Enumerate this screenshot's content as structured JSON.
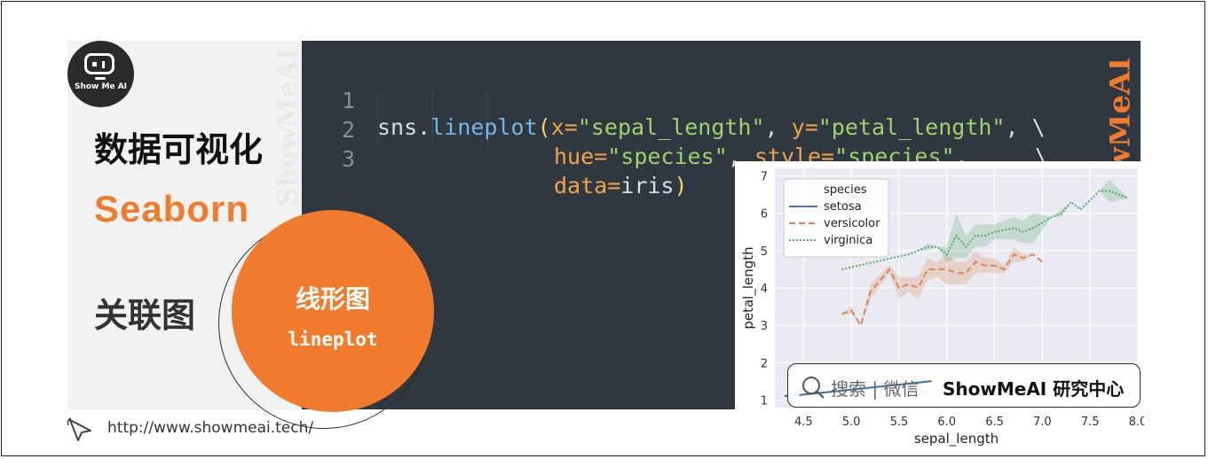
{
  "brand": {
    "logo_text": "Show Me AI",
    "watermark": "ShowMeAI"
  },
  "left": {
    "title_cn": "数据可视化",
    "title_en": "Seaborn",
    "subtitle_cn": "关联图"
  },
  "circle": {
    "title": "线形图",
    "subtitle": "lineplot"
  },
  "code": {
    "lines": [
      {
        "number": "1",
        "parts": [
          {
            "t": "sns.",
            "c": "#d7dde4"
          },
          {
            "t": "lineplot",
            "c": "#74b6e8"
          },
          {
            "t": "(",
            "c": "#f2d36b"
          },
          {
            "t": "x=",
            "c": "#f2a24b"
          },
          {
            "t": "\"sepal_length\"",
            "c": "#9fd26a"
          },
          {
            "t": ", ",
            "c": "#d7dde4"
          },
          {
            "t": "y=",
            "c": "#f2a24b"
          },
          {
            "t": "\"petal_length\"",
            "c": "#9fd26a"
          },
          {
            "t": ", \\",
            "c": "#d7dde4"
          }
        ]
      },
      {
        "number": "2",
        "parts": [
          {
            "t": "hue=",
            "c": "#f2a24b"
          },
          {
            "t": "\"species\"",
            "c": "#9fd26a"
          },
          {
            "t": ", ",
            "c": "#d7dde4"
          },
          {
            "t": "style=",
            "c": "#f2a24b"
          },
          {
            "t": "\"species\"",
            "c": "#9fd26a"
          },
          {
            "t": ",     \\",
            "c": "#d7dde4"
          }
        ]
      },
      {
        "number": "3",
        "parts": [
          {
            "t": "data=",
            "c": "#f2a24b"
          },
          {
            "t": "iris",
            "c": "#d7dde4"
          },
          {
            "t": ")",
            "c": "#f2d36b"
          }
        ]
      }
    ]
  },
  "url": {
    "text": "http://www.showmeai.tech/"
  },
  "search": {
    "placeholder": "搜索 | 微信",
    "brand": "ShowMeAI 研究中心"
  },
  "chart_data": {
    "type": "line",
    "xlabel": "sepal_length",
    "ylabel": "petal_length",
    "xticks": [
      "4.5",
      "5.0",
      "5.5",
      "6.0",
      "6.5",
      "7.0",
      "7.5",
      "8.0"
    ],
    "yticks": [
      "1",
      "2",
      "3",
      "4",
      "5",
      "6",
      "7"
    ],
    "xlim": [
      4.2,
      8.0
    ],
    "ylim": [
      0.8,
      7.2
    ],
    "grid": true,
    "background": "#eaeaf2",
    "legend": {
      "title": "species",
      "placement": "top-left"
    },
    "series": [
      {
        "name": "setosa",
        "color": "#4c72b0",
        "dash": "solid",
        "x": [
          4.3,
          4.6,
          4.9,
          5.2,
          5.5,
          5.8
        ],
        "y": [
          1.1,
          1.3,
          1.45,
          1.5,
          1.4,
          1.2
        ]
      },
      {
        "name": "versicolor",
        "color": "#dd8452",
        "dash": "dashed",
        "x": [
          4.9,
          5.0,
          5.1,
          5.2,
          5.4,
          5.5,
          5.6,
          5.7,
          5.8,
          5.9,
          6.0,
          6.1,
          6.2,
          6.3,
          6.4,
          6.5,
          6.6,
          6.7,
          6.8,
          6.9,
          7.0
        ],
        "y": [
          3.3,
          3.4,
          3.0,
          3.9,
          4.5,
          4.0,
          4.1,
          4.0,
          4.5,
          4.5,
          4.5,
          4.4,
          4.4,
          4.7,
          4.6,
          4.6,
          4.5,
          4.9,
          4.8,
          4.9,
          4.7
        ],
        "band": [
          0,
          0.1,
          0,
          0.2,
          0.1,
          0.3,
          0.2,
          0.3,
          0.3,
          0.2,
          0.4,
          0.3,
          0.3,
          0.3,
          0.2,
          0.2,
          0.1,
          0.2,
          0.1,
          0,
          0
        ]
      },
      {
        "name": "virginica",
        "color": "#55a868",
        "dash": "dotted",
        "x": [
          4.9,
          5.6,
          5.7,
          5.8,
          5.9,
          6.0,
          6.1,
          6.2,
          6.3,
          6.4,
          6.5,
          6.7,
          6.8,
          6.9,
          7.1,
          7.2,
          7.3,
          7.4,
          7.6,
          7.7,
          7.9
        ],
        "y": [
          4.5,
          4.9,
          5.0,
          5.1,
          5.1,
          4.9,
          5.4,
          5.1,
          5.4,
          5.4,
          5.5,
          5.6,
          5.5,
          5.6,
          5.9,
          6.0,
          6.3,
          6.1,
          6.6,
          6.6,
          6.4
        ],
        "band": [
          0,
          0,
          0,
          0.1,
          0,
          0.2,
          0.6,
          0.3,
          0.3,
          0.3,
          0.2,
          0.3,
          0.3,
          0.4,
          0,
          0.1,
          0,
          0,
          0,
          0.3,
          0
        ]
      }
    ]
  }
}
